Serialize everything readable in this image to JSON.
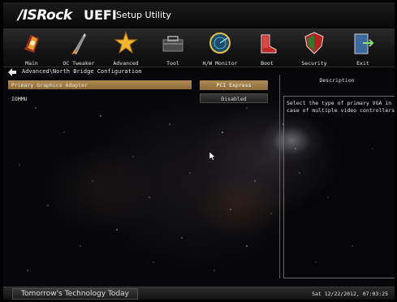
{
  "header": {
    "brand": "/ISRock",
    "uefi": "UEFI",
    "subtitle": "Setup Utility"
  },
  "nav": [
    {
      "label": "Main",
      "icon": "main-icon"
    },
    {
      "label": "OC Tweaker",
      "icon": "rocket-icon"
    },
    {
      "label": "Advanced",
      "icon": "star-icon"
    },
    {
      "label": "Tool",
      "icon": "toolbox-icon"
    },
    {
      "label": "H/W Monitor",
      "icon": "radar-icon"
    },
    {
      "label": "Boot",
      "icon": "boot-icon"
    },
    {
      "label": "Security",
      "icon": "shield-icon"
    },
    {
      "label": "Exit",
      "icon": "exit-door-icon"
    }
  ],
  "breadcrumb": "Advanced\\North Bridge Configuration",
  "settings": [
    {
      "label": "Primary Graphics Adapter",
      "value": "PCI Express"
    },
    {
      "label": "IOMMU",
      "value": "Disabled"
    }
  ],
  "description": {
    "title": "Description",
    "text": "Select the type of primary VGA in\ncase of multiple video controllers."
  },
  "footer": {
    "tagline": "Tomorrow's Technology Today",
    "datetime": "Sat 12/22/2012, 07:03:25"
  },
  "colors": {
    "highlight": "#a07c48",
    "background": "#07070a"
  }
}
